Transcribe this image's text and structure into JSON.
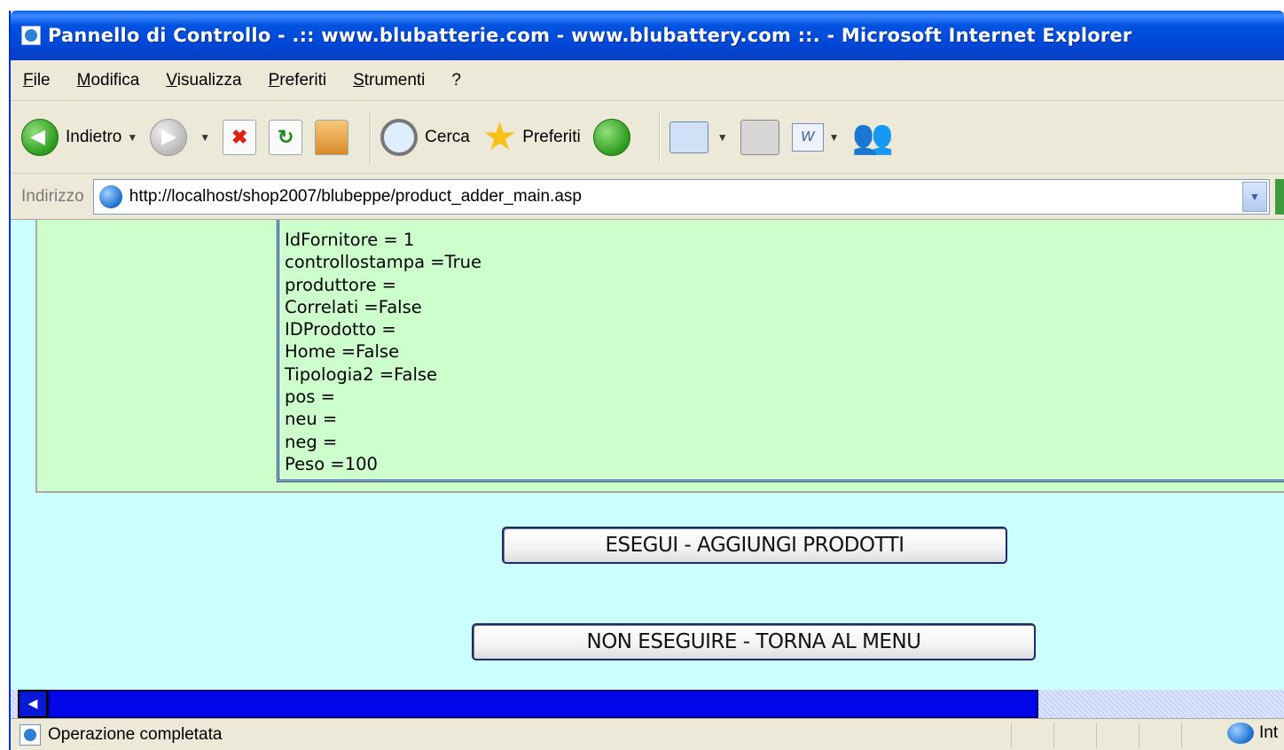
{
  "window": {
    "title": "Pannello di Controllo - .:: www.blubatterie.com - www.blubattery.com ::. - Microsoft Internet Explorer"
  },
  "menu": [
    "File",
    "Modifica",
    "Visualizza",
    "Preferiti",
    "Strumenti",
    "?"
  ],
  "toolbar": {
    "back_label": "Indietro",
    "search_label": "Cerca",
    "favorites_label": "Preferiti"
  },
  "address": {
    "label": "Indirizzo",
    "url": "http://localhost/shop2007/blubeppe/product_adder_main.asp"
  },
  "fields": [
    "IdFornitore = 1",
    "controllostampa =True",
    "produttore =",
    "Correlati =False",
    "IDProdotto =",
    "Home =False",
    "Tipologia2 =False",
    "pos =",
    "neu =",
    "neg =",
    "Peso =100"
  ],
  "actions": {
    "execute_label": "ESEGUI - AGGIUNGI PRODOTTI",
    "cancel_label": "NON ESEGUIRE - TORNA AL MENU"
  },
  "status": {
    "text": "Operazione completata",
    "zone": "Int"
  },
  "colors": {
    "content_bg": "#CCFFFF",
    "panel_bg": "#CCFFCC",
    "titlebar": "#0047D6"
  }
}
